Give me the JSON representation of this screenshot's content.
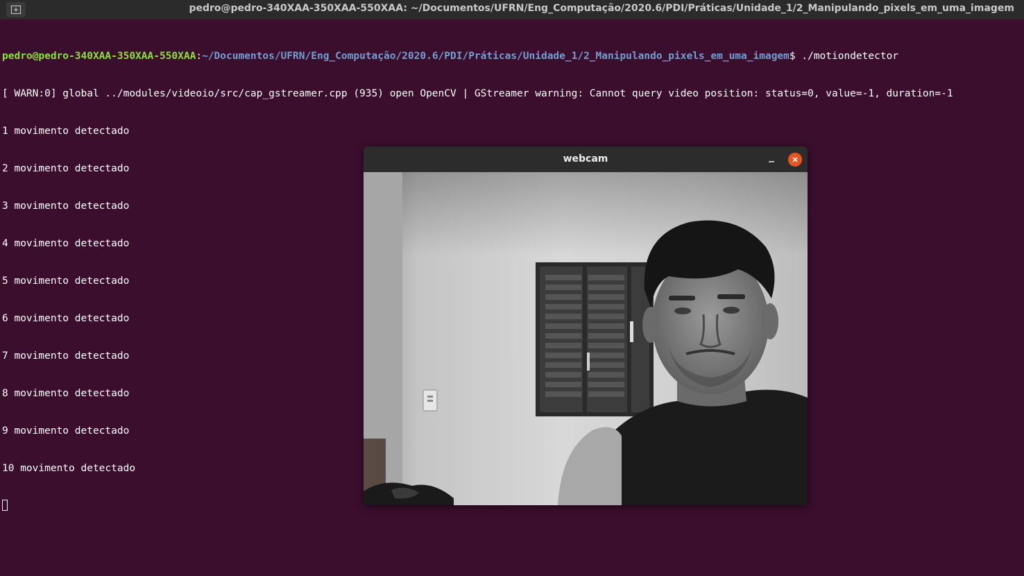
{
  "terminal": {
    "title": "pedro@pedro-340XAA-350XAA-550XAA: ~/Documentos/UFRN/Eng_Computação/2020.6/PDI/Práticas/Unidade_1/2_Manipulando_pixels_em_uma_imagem",
    "new_tab_icon": "new-tab-icon",
    "prompt_user": "pedro@pedro-340XAA-350XAA-550XAA",
    "prompt_sep": ":",
    "prompt_path": "~/Documentos/UFRN/Eng_Computação/2020.6/PDI/Práticas/Unidade_1/2_Manipulando_pixels_em_uma_imagem",
    "prompt_symbol": "$ ",
    "command": "./motiondetector",
    "warning_line": "[ WARN:0] global ../modules/videoio/src/cap_gstreamer.cpp (935) open OpenCV | GStreamer warning: Cannot query video position: status=0, value=-1, duration=-1",
    "output_lines": [
      "1 movimento detectado",
      "2 movimento detectado",
      "3 movimento detectado",
      "4 movimento detectado",
      "5 movimento detectado",
      "6 movimento detectado",
      "7 movimento detectado",
      "8 movimento detectado",
      "9 movimento detectado",
      "10 movimento detectado"
    ],
    "colors": {
      "background": "#3b0e2e",
      "prompt_user": "#8ae234",
      "prompt_path": "#729fcf",
      "text": "#ffffff"
    }
  },
  "webcam_window": {
    "title": "webcam",
    "minimize_icon": "minimize-icon",
    "close_icon": "close-icon",
    "close_color": "#e95420"
  }
}
